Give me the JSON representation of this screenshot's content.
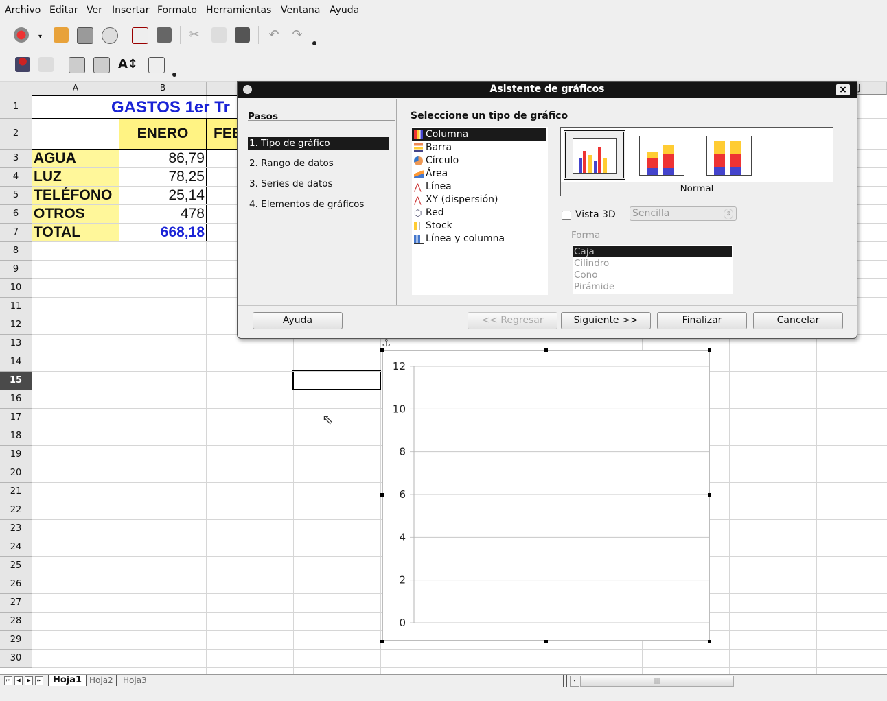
{
  "menu": [
    "Archivo",
    "Editar",
    "Ver",
    "Insertar",
    "Formato",
    "Herramientas",
    "Ventana",
    "Ayuda"
  ],
  "columns": [
    "A",
    "B",
    "",
    "",
    "",
    "",
    "",
    "",
    "",
    "J"
  ],
  "rows": [
    "1",
    "2",
    "3",
    "4",
    "5",
    "6",
    "7",
    "8",
    "9",
    "10",
    "11",
    "12",
    "13",
    "14",
    "15",
    "16",
    "17",
    "18",
    "19",
    "20",
    "21",
    "22",
    "23",
    "24",
    "25",
    "26",
    "27",
    "28",
    "29",
    "30"
  ],
  "sheet": {
    "title": "GASTOS 1er Tr",
    "month_header": "ENERO",
    "month_header_2": "FEB",
    "labels": [
      "AGUA",
      "LUZ",
      "TELÉFONO",
      "OTROS",
      "TOTAL"
    ],
    "values": [
      "86,79",
      "78,25",
      "25,14",
      "478",
      "668,18"
    ]
  },
  "dialog": {
    "title": "Asistente de gráficos",
    "close": "×",
    "steps_heading": "Pasos",
    "steps": [
      "1. Tipo de gráfico",
      "2. Rango de datos",
      "3. Series de datos",
      "4. Elementos de gráficos"
    ],
    "type_heading": "Seleccione un tipo de gráfico",
    "chart_types": [
      "Columna",
      "Barra",
      "Círculo",
      "Área",
      "Línea",
      "XY (dispersión)",
      "Red",
      "Stock",
      "Línea y columna"
    ],
    "variant_label": "Normal",
    "vista3d_label": "Vista 3D",
    "vista3d_select": "Sencilla",
    "forma_label": "Forma",
    "shapes": [
      "Caja",
      "Cilindro",
      "Cono",
      "Pirámide"
    ],
    "buttons": {
      "help": "Ayuda",
      "back": "<< Regresar",
      "next": "Siguiente >>",
      "finish": "Finalizar",
      "cancel": "Cancelar"
    }
  },
  "chart": {
    "y_ticks": [
      "12",
      "10",
      "8",
      "6",
      "4",
      "2",
      "0"
    ]
  },
  "tabs": [
    "Hoja1",
    "Hoja2",
    "Hoja3"
  ],
  "colors": {
    "title_blue": "#1a23d6",
    "label_yellow": "#fff79a",
    "header_yellow": "#fff383",
    "selection": "#1a1a1a"
  }
}
